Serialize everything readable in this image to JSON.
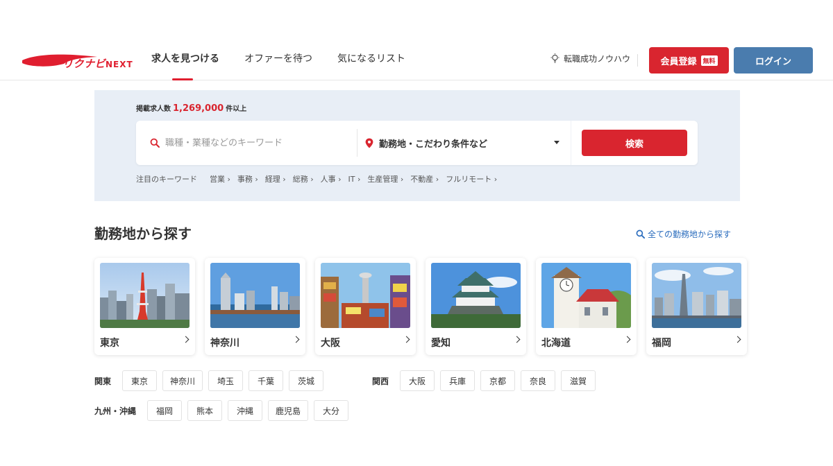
{
  "header": {
    "logo_text": "リクナビ",
    "logo_suffix": "NEXT",
    "nav": [
      {
        "label": "求人を見つける",
        "active": true
      },
      {
        "label": "オファーを待つ",
        "active": false
      },
      {
        "label": "気になるリスト",
        "active": false
      }
    ],
    "knowhow_label": "転職成功ノウハウ",
    "knowhow_icon": "lightbulb-icon",
    "register_label": "会員登録",
    "register_badge": "無料",
    "login_label": "ログイン",
    "brand_color": "#e01e2f",
    "login_color": "#4a7cae"
  },
  "search": {
    "count_prefix": "掲載求人数",
    "count": "1,269,000",
    "count_suffix": "件以上",
    "keyword_placeholder": "職種・業種などのキーワード",
    "keyword_icon": "search-icon",
    "location_label": "勤務地・こだわり条件など",
    "location_icon": "map-pin-icon",
    "search_button": "検索",
    "popular_label": "注目のキーワード",
    "popular": [
      "営業 ›",
      "事務 ›",
      "経理 ›",
      "総務 ›",
      "人事 ›",
      "IT ›",
      "生産管理 ›",
      "不動産 ›",
      "フルリモート ›"
    ]
  },
  "areas": {
    "title": "勤務地から探す",
    "all_link": "全ての勤務地から探す",
    "cards": [
      {
        "label": "東京"
      },
      {
        "label": "神奈川"
      },
      {
        "label": "大阪"
      },
      {
        "label": "愛知"
      },
      {
        "label": "北海道"
      },
      {
        "label": "福岡"
      }
    ],
    "regions": [
      {
        "label": "関東",
        "items": [
          "東京",
          "神奈川",
          "埼玉",
          "千葉",
          "茨城"
        ]
      },
      {
        "label": "関西",
        "items": [
          "大阪",
          "兵庫",
          "京都",
          "奈良",
          "滋賀"
        ]
      },
      {
        "label": "九州・沖縄",
        "items": [
          "福岡",
          "熊本",
          "沖縄",
          "鹿児島",
          "大分"
        ]
      }
    ]
  }
}
